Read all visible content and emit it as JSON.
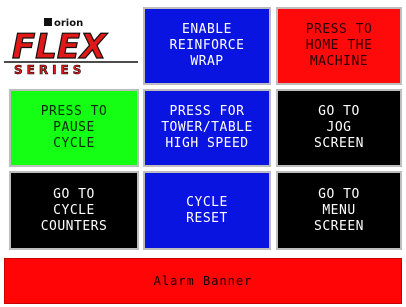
{
  "logo": {
    "brand_small": "orion",
    "brand_main": "FLEX",
    "brand_sub": "SERIES"
  },
  "buttons": {
    "enable_reinforce_wrap": "ENABLE\nREINFORCE\nWRAP",
    "home_machine": "PRESS TO\nHOME THE\nMACHINE",
    "pause_cycle": "PRESS TO\nPAUSE\nCYCLE",
    "tower_table_high_speed": "PRESS FOR\nTOWER/TABLE\nHIGH SPEED",
    "jog_screen": "GO TO\nJOG\nSCREEN",
    "cycle_counters": "GO TO\nCYCLE\nCOUNTERS",
    "cycle_reset": "CYCLE\nRESET",
    "menu_screen": "GO TO\nMENU\nSCREEN"
  },
  "alarm_banner": "Alarm Banner",
  "colors": {
    "blue": "#0a14e0",
    "red": "#ff0a0a",
    "green": "#14ff14",
    "black": "#000000"
  }
}
